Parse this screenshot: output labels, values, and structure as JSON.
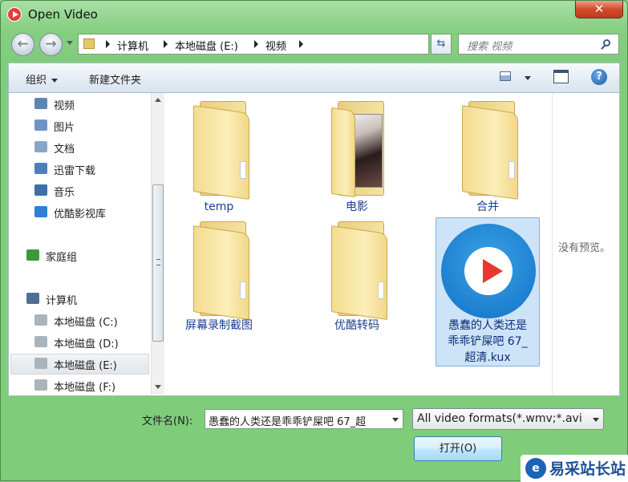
{
  "window": {
    "title": "Open Video",
    "close_label": "✕"
  },
  "address": {
    "crumbs": [
      "计算机",
      "本地磁盘 (E:)",
      "视频"
    ],
    "search_placeholder": "搜索 视频"
  },
  "toolbar": {
    "organize_label": "组织",
    "new_folder_label": "新建文件夹",
    "help_label": "?"
  },
  "sidebar": {
    "items": [
      {
        "label": "视频",
        "icon": "video-library-icon"
      },
      {
        "label": "图片",
        "icon": "pictures-library-icon"
      },
      {
        "label": "文档",
        "icon": "documents-library-icon"
      },
      {
        "label": "迅雷下载",
        "icon": "download-library-icon"
      },
      {
        "label": "音乐",
        "icon": "music-library-icon"
      },
      {
        "label": "优酷影视库",
        "icon": "youku-library-icon"
      },
      {
        "label": "家庭组",
        "icon": "homegroup-icon"
      },
      {
        "label": "计算机",
        "icon": "computer-icon"
      },
      {
        "label": "本地磁盘 (C:)",
        "icon": "drive-icon"
      },
      {
        "label": "本地磁盘 (D:)",
        "icon": "drive-icon"
      },
      {
        "label": "本地磁盘 (E:)",
        "icon": "drive-icon",
        "selected": true
      },
      {
        "label": "本地磁盘 (F:)",
        "icon": "drive-icon"
      }
    ]
  },
  "files": [
    {
      "name": "temp",
      "type": "folder"
    },
    {
      "name": "电影",
      "type": "folder-with-photo"
    },
    {
      "name": "合并",
      "type": "folder"
    },
    {
      "name": "屏幕录制截图",
      "type": "folder"
    },
    {
      "name": "优酷转码",
      "type": "folder"
    },
    {
      "name": "愚蠢的人类还是乖乖铲屎吧 67_超清.kux",
      "type": "kux-file",
      "selected": true,
      "lines": [
        "愚蠢的人类还是",
        "乖乖铲屎吧 67_",
        "超清.kux"
      ]
    }
  ],
  "preview": {
    "text": "没有预览。"
  },
  "footer": {
    "filename_label": "文件名(N):",
    "filename_value": "愚蠢的人类还是乖乖铲屎吧 67_超",
    "filter_value": "All video formats(*.wmv;*.avi",
    "open_label": "打开(O)"
  },
  "watermark": {
    "logo": "e",
    "text": "易采站长站"
  },
  "colors": {
    "window_frame": "#86cf82",
    "selection": "#cde3f7",
    "link_text": "#1b3f8f",
    "close_button": "#d24c2c"
  }
}
